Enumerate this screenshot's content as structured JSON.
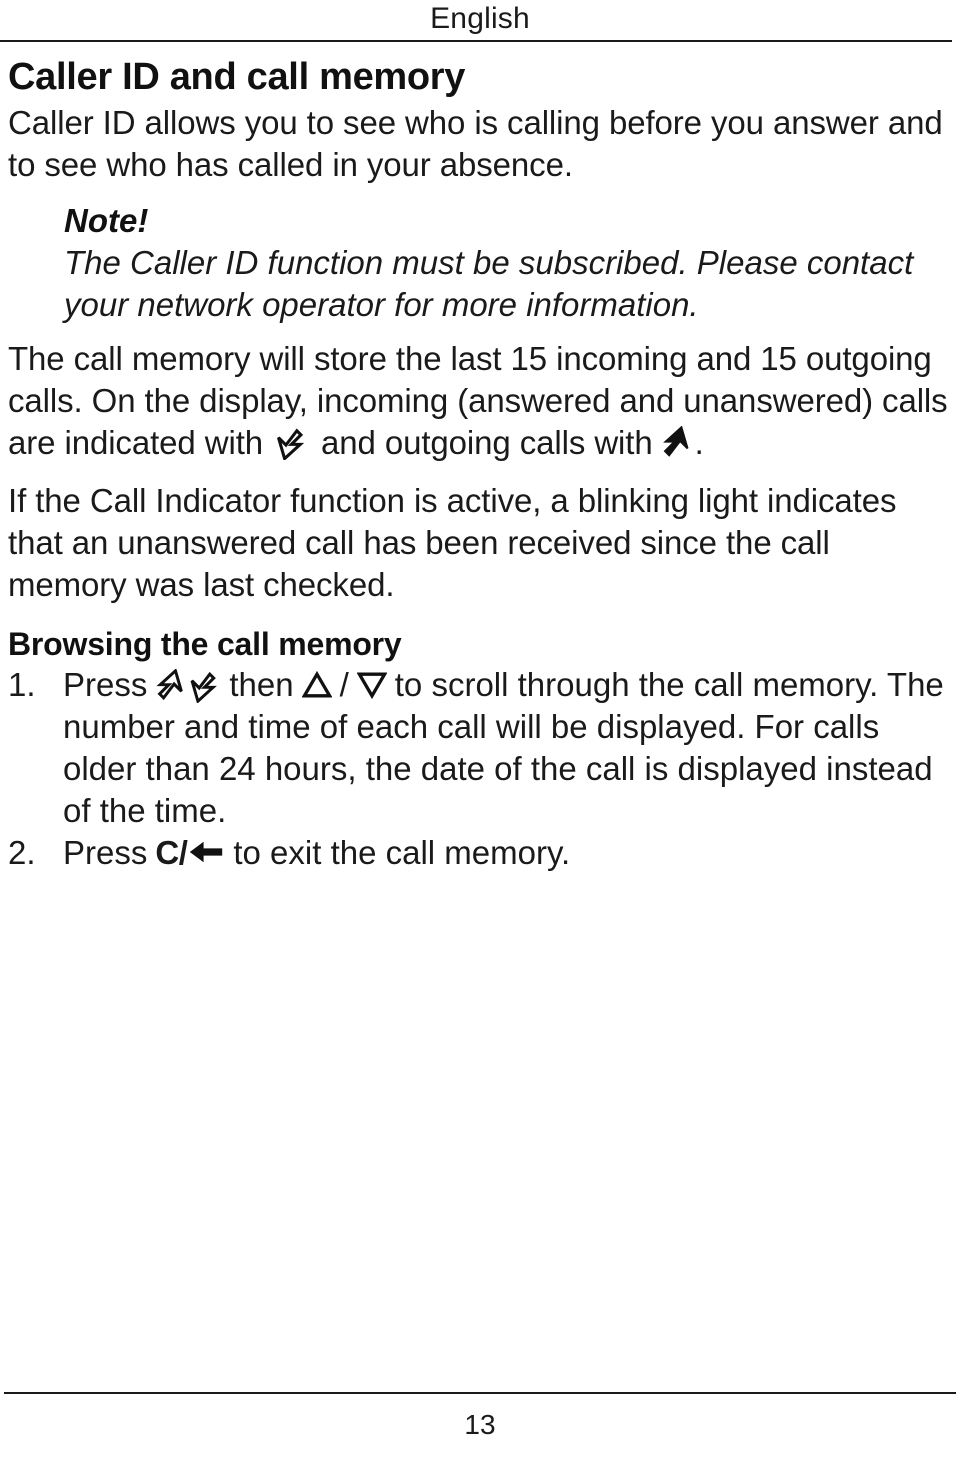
{
  "header": {
    "language": "English"
  },
  "document": {
    "title": "Caller ID and call memory",
    "intro": "Caller ID allows you to see who is calling before you answer and to see who has called in your absence.",
    "note": {
      "label": "Note!",
      "text": "The Caller ID function must be subscribed. Please contact your network operator for more information."
    },
    "paragraph_memory": {
      "part1": "The call memory will store the last 15 incoming and 15 outgoing calls. On the display, incoming (answered and unanswered) calls are indicated with",
      "part2": "and outgoing calls with",
      "part3": "."
    },
    "paragraph_indicator": "If the Call Indicator function is active, a blinking light indicates that an unanswered call has been received since the call memory was last checked.",
    "section": {
      "title": "Browsing the call memory",
      "steps": [
        {
          "number": "1.",
          "part1": "Press",
          "part2": "then",
          "separator": "/",
          "part3": "to scroll through the call memory. The number and time of each call will be displayed. For calls older than 24 hours, the date of the call is displayed instead of the time."
        },
        {
          "number": "2.",
          "part1": "Press",
          "key_label": "C/",
          "part3": "to exit the call memory."
        }
      ]
    }
  },
  "footer": {
    "page_number": "13"
  },
  "icons": {
    "incoming_call": "incoming-call-arrow-icon",
    "outgoing_call": "outgoing-call-arrow-icon",
    "call_list": "call-list-arrows-icon",
    "scroll_up": "triangle-up-icon",
    "scroll_down": "triangle-down-icon",
    "clear_back": "left-arrow-icon"
  },
  "colors": {
    "text": "#1a1a1a",
    "rule": "#1a1a1a",
    "background": "#ffffff"
  }
}
